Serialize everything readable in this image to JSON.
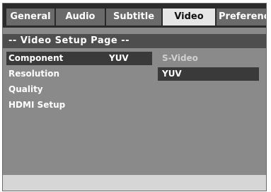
{
  "tabs": [
    {
      "label": "General"
    },
    {
      "label": "Audio"
    },
    {
      "label": "Subtitle"
    },
    {
      "label": "Video"
    },
    {
      "label": "Preference"
    }
  ],
  "page_title": "-- Video Setup Page --",
  "menu": [
    {
      "label": "Component",
      "value": "YUV"
    },
    {
      "label": "Resolution"
    },
    {
      "label": "Quality"
    },
    {
      "label": "HDMI Setup"
    }
  ],
  "options": [
    {
      "label": "S-Video"
    },
    {
      "label": "YUV"
    }
  ],
  "active_tab": "Video"
}
